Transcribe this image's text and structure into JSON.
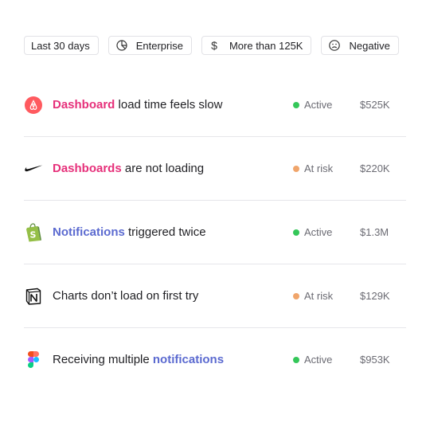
{
  "filters": [
    {
      "label": "Last 30 days",
      "icon": "calendar"
    },
    {
      "label": "Enterprise",
      "icon": "pie-chart-icon"
    },
    {
      "label": "More than 125K",
      "icon": "dollar-icon"
    },
    {
      "label": "Negative",
      "icon": "frown-face-icon"
    }
  ],
  "rows": [
    {
      "logo": "airbnb-logo",
      "highlight": "Dashboard",
      "rest": " load time feels slow",
      "status": "Active",
      "amount": "$525K"
    },
    {
      "logo": "nike-logo",
      "highlight": "Dashboards",
      "rest": " are not loading",
      "status": "At risk",
      "amount": "$220K"
    },
    {
      "logo": "shopify-logo",
      "highlight": "Notifications",
      "rest": " triggered twice",
      "status": "Active",
      "amount": "$1.3M"
    },
    {
      "logo": "notion-logo",
      "text": "Charts don’t load on first try",
      "status": "At risk",
      "amount": "$129K"
    },
    {
      "logo": "figma-logo",
      "prefix": "Receiving multiple ",
      "highlight": "notifications",
      "status": "Active",
      "amount": "$953K"
    }
  ],
  "colors": {
    "pink_highlight": "#e6307a",
    "blue_highlight": "#5b6ad0",
    "active_dot": "#34c759",
    "risk_dot": "#f0a56b"
  }
}
